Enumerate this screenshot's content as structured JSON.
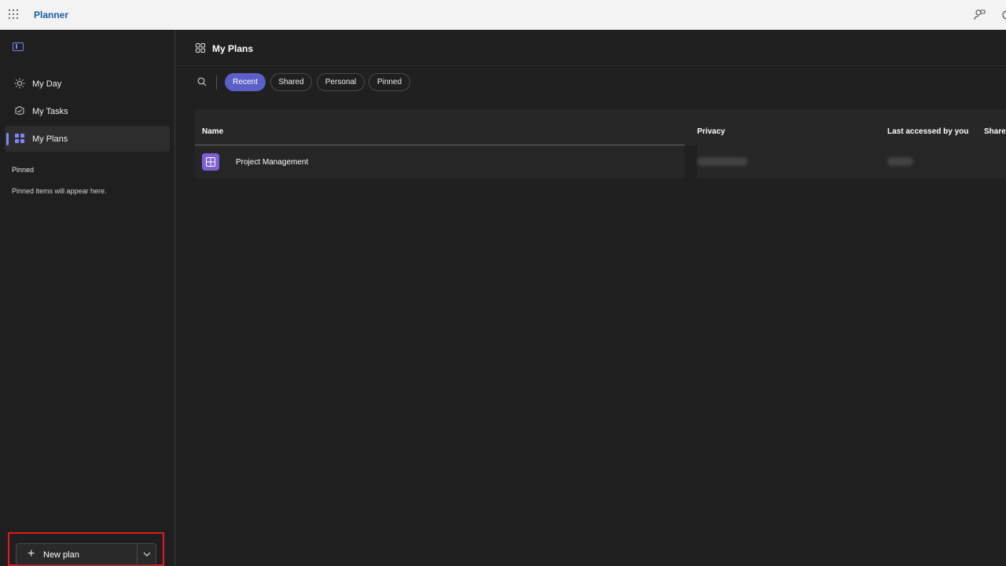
{
  "topbar": {
    "app_name": "Planner",
    "icons": [
      "app-launcher-icon",
      "people-settings-icon",
      "settings-icon"
    ]
  },
  "sidebar": {
    "collapse_icon": "sidebar-collapse-icon",
    "items": [
      {
        "label": "My Day",
        "icon": "sun-icon",
        "active": false
      },
      {
        "label": "My Tasks",
        "icon": "task-circle-icon",
        "active": false
      },
      {
        "label": "My Plans",
        "icon": "grid-icon",
        "active": true
      }
    ],
    "pinned_title": "Pinned",
    "pinned_empty": "Pinned items will appear here.",
    "new_plan_label": "New plan"
  },
  "main": {
    "title": "My Plans",
    "filters": [
      {
        "label": "Recent",
        "selected": true
      },
      {
        "label": "Shared",
        "selected": false
      },
      {
        "label": "Personal",
        "selected": false
      },
      {
        "label": "Pinned",
        "selected": false
      }
    ],
    "table": {
      "columns": [
        "Name",
        "Privacy",
        "Last accessed by you",
        "Share"
      ],
      "rows": [
        {
          "name": "Project Management",
          "privacy": "",
          "last_accessed": "",
          "shared": ""
        }
      ]
    }
  },
  "colors": {
    "accent": "#5b5fc7",
    "accent_light": "#7f85f5",
    "plan_icon": "#7f5fd6",
    "highlight_box": "#e01b1b",
    "background": "#202020"
  }
}
